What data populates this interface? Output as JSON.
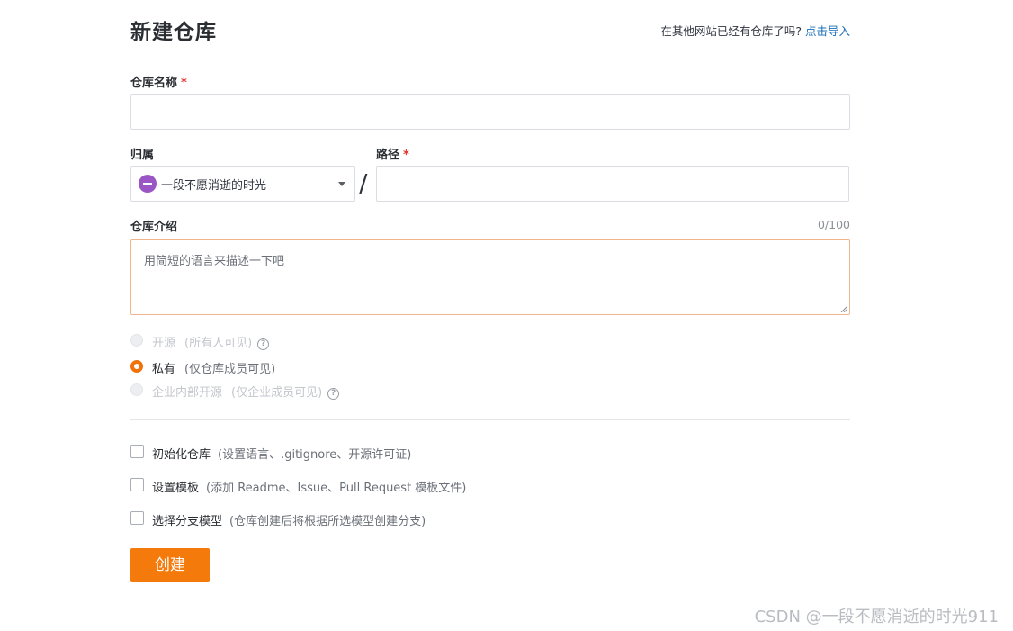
{
  "header": {
    "title": "新建仓库",
    "import_prompt": "在其他网站已经有仓库了吗?",
    "import_link": "点击导入"
  },
  "form": {
    "name_label": "仓库名称",
    "required_mark": "*",
    "name_value": "",
    "owner_label": "归属",
    "owner_value": "一段不愿消逝的时光",
    "path_label": "路径",
    "path_value": "",
    "separator": "/",
    "desc_label": "仓库介绍",
    "desc_counter": "0/100",
    "desc_placeholder": "用简短的语言来描述一下吧"
  },
  "visibility": [
    {
      "label": "开源",
      "hint": "(所有人可见)",
      "state": "disabled",
      "help": true
    },
    {
      "label": "私有",
      "hint": "(仅仓库成员可见)",
      "state": "checked",
      "help": false
    },
    {
      "label": "企业内部开源",
      "hint": "(仅企业成员可见)",
      "state": "disabled",
      "help": true
    }
  ],
  "options": [
    {
      "label": "初始化仓库",
      "hint": "(设置语言、.gitignore、开源许可证)",
      "checked": false
    },
    {
      "label": "设置模板",
      "hint": "(添加 Readme、Issue、Pull Request 模板文件)",
      "checked": false
    },
    {
      "label": "选择分支模型",
      "hint": "(仓库创建后将根据所选模型创建分支)",
      "checked": false
    }
  ],
  "actions": {
    "create_label": "创建"
  },
  "watermark": "CSDN @一段不愿消逝的时光911",
  "colors": {
    "accent": "#f57a0c",
    "link": "#1a6fb8",
    "required": "#e5312c",
    "avatar": "#9a56c4"
  },
  "icons": {
    "help": "question-circle-icon",
    "dropdown": "caret-down-icon",
    "avatar": "avatar-icon"
  }
}
